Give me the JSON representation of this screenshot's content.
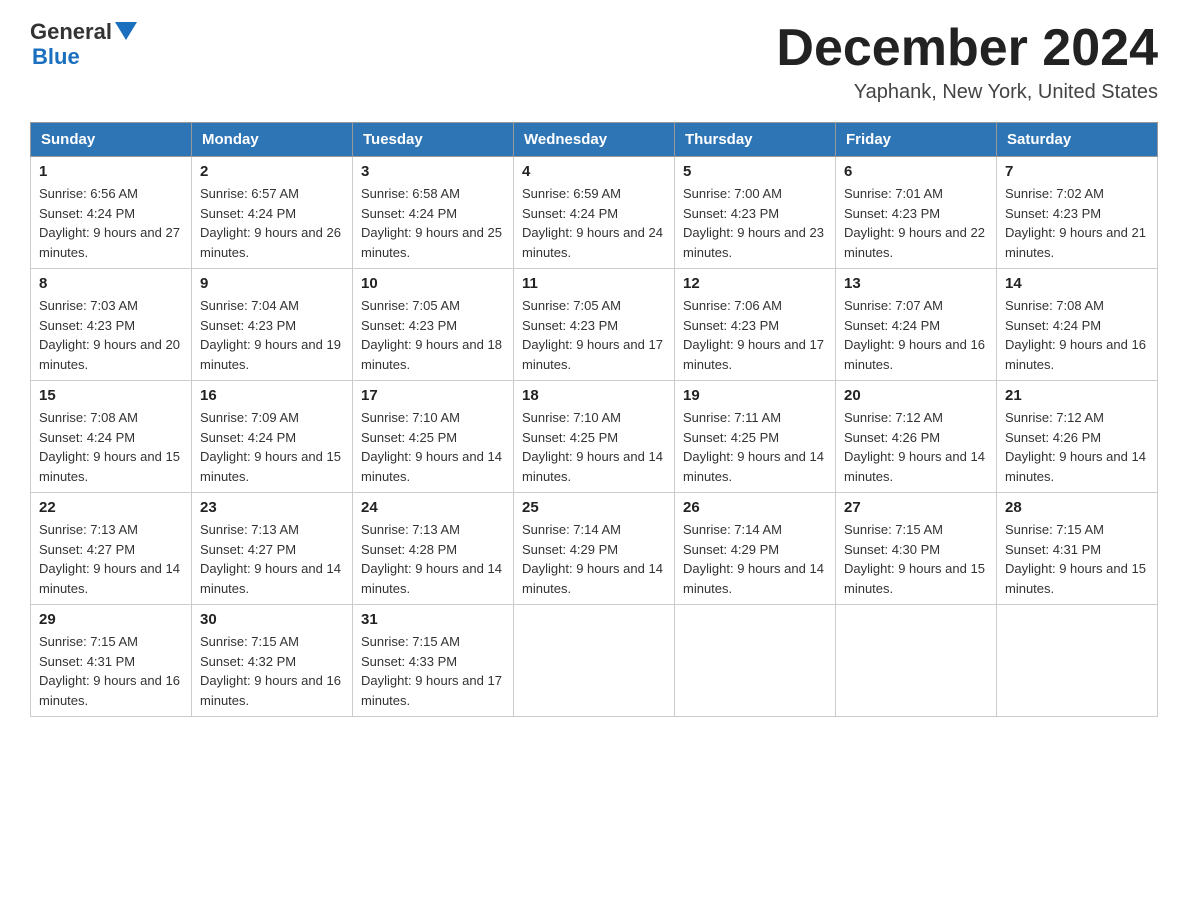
{
  "header": {
    "logo_line1": "General",
    "logo_line2": "Blue",
    "month_title": "December 2024",
    "location": "Yaphank, New York, United States"
  },
  "days_of_week": [
    "Sunday",
    "Monday",
    "Tuesday",
    "Wednesday",
    "Thursday",
    "Friday",
    "Saturday"
  ],
  "weeks": [
    [
      {
        "day": "1",
        "sunrise": "6:56 AM",
        "sunset": "4:24 PM",
        "daylight": "9 hours and 27 minutes."
      },
      {
        "day": "2",
        "sunrise": "6:57 AM",
        "sunset": "4:24 PM",
        "daylight": "9 hours and 26 minutes."
      },
      {
        "day": "3",
        "sunrise": "6:58 AM",
        "sunset": "4:24 PM",
        "daylight": "9 hours and 25 minutes."
      },
      {
        "day": "4",
        "sunrise": "6:59 AM",
        "sunset": "4:24 PM",
        "daylight": "9 hours and 24 minutes."
      },
      {
        "day": "5",
        "sunrise": "7:00 AM",
        "sunset": "4:23 PM",
        "daylight": "9 hours and 23 minutes."
      },
      {
        "day": "6",
        "sunrise": "7:01 AM",
        "sunset": "4:23 PM",
        "daylight": "9 hours and 22 minutes."
      },
      {
        "day": "7",
        "sunrise": "7:02 AM",
        "sunset": "4:23 PM",
        "daylight": "9 hours and 21 minutes."
      }
    ],
    [
      {
        "day": "8",
        "sunrise": "7:03 AM",
        "sunset": "4:23 PM",
        "daylight": "9 hours and 20 minutes."
      },
      {
        "day": "9",
        "sunrise": "7:04 AM",
        "sunset": "4:23 PM",
        "daylight": "9 hours and 19 minutes."
      },
      {
        "day": "10",
        "sunrise": "7:05 AM",
        "sunset": "4:23 PM",
        "daylight": "9 hours and 18 minutes."
      },
      {
        "day": "11",
        "sunrise": "7:05 AM",
        "sunset": "4:23 PM",
        "daylight": "9 hours and 17 minutes."
      },
      {
        "day": "12",
        "sunrise": "7:06 AM",
        "sunset": "4:23 PM",
        "daylight": "9 hours and 17 minutes."
      },
      {
        "day": "13",
        "sunrise": "7:07 AM",
        "sunset": "4:24 PM",
        "daylight": "9 hours and 16 minutes."
      },
      {
        "day": "14",
        "sunrise": "7:08 AM",
        "sunset": "4:24 PM",
        "daylight": "9 hours and 16 minutes."
      }
    ],
    [
      {
        "day": "15",
        "sunrise": "7:08 AM",
        "sunset": "4:24 PM",
        "daylight": "9 hours and 15 minutes."
      },
      {
        "day": "16",
        "sunrise": "7:09 AM",
        "sunset": "4:24 PM",
        "daylight": "9 hours and 15 minutes."
      },
      {
        "day": "17",
        "sunrise": "7:10 AM",
        "sunset": "4:25 PM",
        "daylight": "9 hours and 14 minutes."
      },
      {
        "day": "18",
        "sunrise": "7:10 AM",
        "sunset": "4:25 PM",
        "daylight": "9 hours and 14 minutes."
      },
      {
        "day": "19",
        "sunrise": "7:11 AM",
        "sunset": "4:25 PM",
        "daylight": "9 hours and 14 minutes."
      },
      {
        "day": "20",
        "sunrise": "7:12 AM",
        "sunset": "4:26 PM",
        "daylight": "9 hours and 14 minutes."
      },
      {
        "day": "21",
        "sunrise": "7:12 AM",
        "sunset": "4:26 PM",
        "daylight": "9 hours and 14 minutes."
      }
    ],
    [
      {
        "day": "22",
        "sunrise": "7:13 AM",
        "sunset": "4:27 PM",
        "daylight": "9 hours and 14 minutes."
      },
      {
        "day": "23",
        "sunrise": "7:13 AM",
        "sunset": "4:27 PM",
        "daylight": "9 hours and 14 minutes."
      },
      {
        "day": "24",
        "sunrise": "7:13 AM",
        "sunset": "4:28 PM",
        "daylight": "9 hours and 14 minutes."
      },
      {
        "day": "25",
        "sunrise": "7:14 AM",
        "sunset": "4:29 PM",
        "daylight": "9 hours and 14 minutes."
      },
      {
        "day": "26",
        "sunrise": "7:14 AM",
        "sunset": "4:29 PM",
        "daylight": "9 hours and 14 minutes."
      },
      {
        "day": "27",
        "sunrise": "7:15 AM",
        "sunset": "4:30 PM",
        "daylight": "9 hours and 15 minutes."
      },
      {
        "day": "28",
        "sunrise": "7:15 AM",
        "sunset": "4:31 PM",
        "daylight": "9 hours and 15 minutes."
      }
    ],
    [
      {
        "day": "29",
        "sunrise": "7:15 AM",
        "sunset": "4:31 PM",
        "daylight": "9 hours and 16 minutes."
      },
      {
        "day": "30",
        "sunrise": "7:15 AM",
        "sunset": "4:32 PM",
        "daylight": "9 hours and 16 minutes."
      },
      {
        "day": "31",
        "sunrise": "7:15 AM",
        "sunset": "4:33 PM",
        "daylight": "9 hours and 17 minutes."
      },
      null,
      null,
      null,
      null
    ]
  ]
}
